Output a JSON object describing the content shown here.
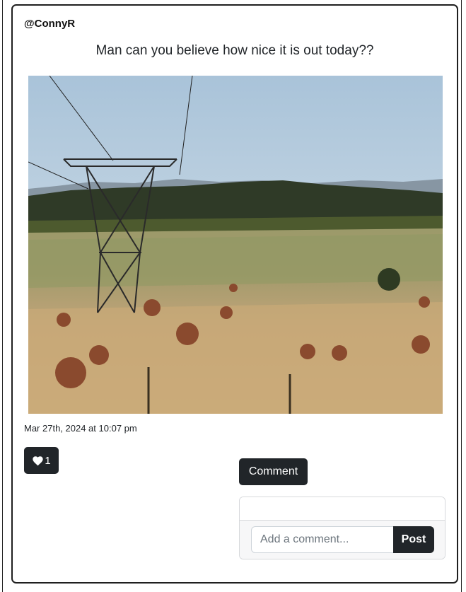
{
  "post": {
    "username": "@ConnyR",
    "text": "Man can you believe how nice it is out today??",
    "timestamp": "Mar 27th, 2024 at 10:07 pm",
    "photo_icon": "landscape-photo",
    "likes": {
      "icon": "heart-icon",
      "count": "1"
    }
  },
  "comments": {
    "toggle_label": "Comment",
    "input_placeholder": "Add a comment...",
    "input_value": "",
    "submit_label": "Post"
  },
  "colors": {
    "button_dark": "#212529",
    "card_border": "#1f1f1f",
    "panel_border": "#d7d9dc"
  }
}
